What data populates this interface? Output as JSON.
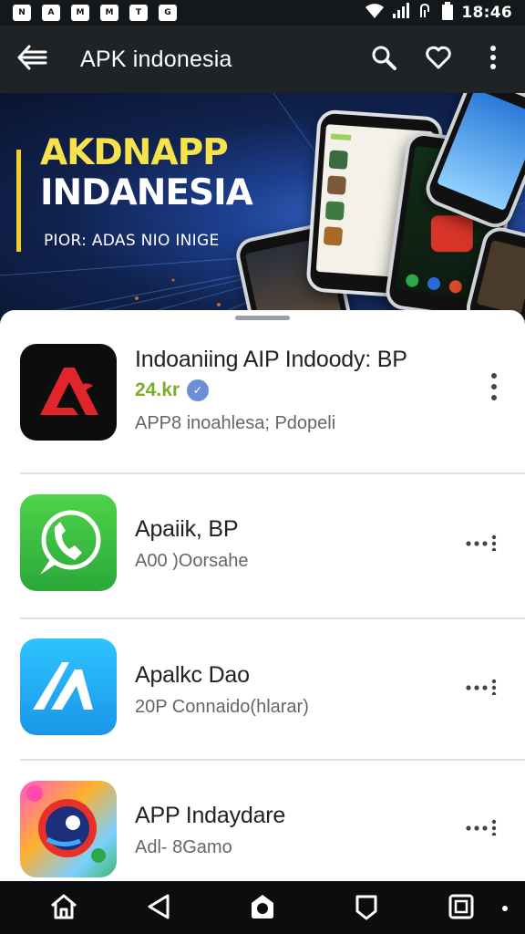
{
  "status_bar": {
    "notifications": [
      "N",
      "A",
      "M",
      "M",
      "T",
      "G"
    ],
    "time": "18:46"
  },
  "app_bar": {
    "title": "APK indonesia"
  },
  "banner": {
    "title_line1": "AKDNAPP",
    "title_line2": "INDANESIA",
    "subtitle": "PIOR: ADAS NIO INIGE"
  },
  "apps": [
    {
      "name": "Indoaniing AIP Indoody: BP",
      "rating": "24.kr",
      "subtitle": "APP8 inoahlesa; Pdopeli",
      "icon": "red-a-app-icon"
    },
    {
      "name": "Apaiik, BP",
      "subtitle": "A00 )Oorsahe",
      "icon": "green-phone-app-icon"
    },
    {
      "name": "Apalkc Dao",
      "subtitle": "20P Connaido(hlarar)",
      "icon": "blue-a-app-icon"
    },
    {
      "name": "APP Indaydare",
      "subtitle": "Adl- 8Gamo",
      "icon": "colorful-app-icon"
    }
  ],
  "colors": {
    "app_bar": "#202326",
    "rating_green": "#7cae2a",
    "banner_accent": "#f2d21f"
  }
}
